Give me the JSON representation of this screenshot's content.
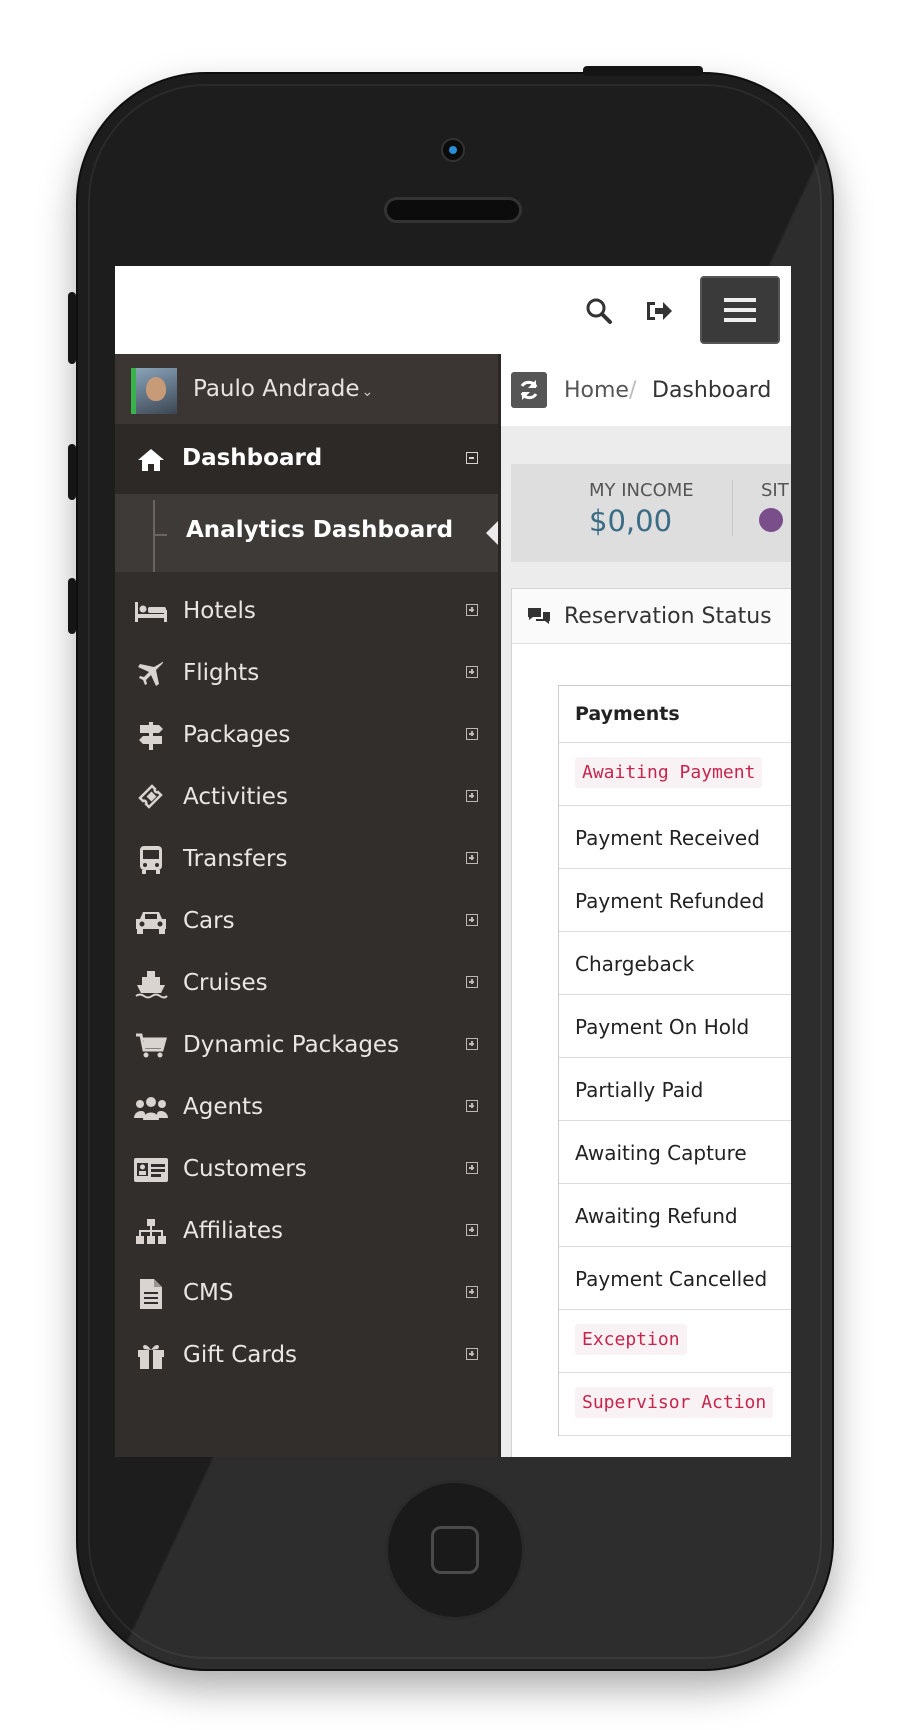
{
  "topbar": {
    "search_icon": "search-icon",
    "logout_icon": "sign-out-icon",
    "menu_icon": "hamburger-icon"
  },
  "user": {
    "name": "Paulo Andrade",
    "caret": "⌄"
  },
  "nav": {
    "dashboard": {
      "label": "Dashboard",
      "icon": "home-icon"
    },
    "analytics": {
      "label": "Analytics Dashboard"
    },
    "items": [
      {
        "label": "Hotels",
        "icon": "bed-icon"
      },
      {
        "label": "Flights",
        "icon": "plane-icon"
      },
      {
        "label": "Packages",
        "icon": "signpost-icon"
      },
      {
        "label": "Activities",
        "icon": "ticket-icon"
      },
      {
        "label": "Transfers",
        "icon": "bus-icon"
      },
      {
        "label": "Cars",
        "icon": "car-icon"
      },
      {
        "label": "Cruises",
        "icon": "ship-icon"
      },
      {
        "label": "Dynamic Packages",
        "icon": "cart-icon"
      },
      {
        "label": "Agents",
        "icon": "users-icon"
      },
      {
        "label": "Customers",
        "icon": "id-card-icon"
      },
      {
        "label": "Affiliates",
        "icon": "sitemap-icon"
      },
      {
        "label": "CMS",
        "icon": "file-icon"
      },
      {
        "label": "Gift Cards",
        "icon": "gift-icon"
      }
    ]
  },
  "breadcrumb": {
    "home": "Home",
    "separator": "/",
    "current": "Dashboard"
  },
  "stats": {
    "income_label": "MY INCOME",
    "income_value": "$0,00",
    "second_label": "SIT"
  },
  "panel": {
    "title": "Reservation Status",
    "table_header": "Payments",
    "rows": [
      {
        "text": "Awaiting Payment",
        "style": "code"
      },
      {
        "text": "Payment Received",
        "style": "plain"
      },
      {
        "text": "Payment Refunded",
        "style": "plain"
      },
      {
        "text": "Chargeback",
        "style": "plain"
      },
      {
        "text": "Payment On Hold",
        "style": "plain"
      },
      {
        "text": "Partially Paid",
        "style": "plain"
      },
      {
        "text": "Awaiting Capture",
        "style": "plain"
      },
      {
        "text": "Awaiting Refund",
        "style": "plain"
      },
      {
        "text": "Payment Cancelled",
        "style": "plain"
      },
      {
        "text": "Exception",
        "style": "code"
      },
      {
        "text": "Supervisor Action",
        "style": "code"
      }
    ]
  },
  "colors": {
    "sidebar_bg": "#322e2c",
    "income_value": "#3b6c86",
    "code_text": "#c7254e",
    "avatar_accent": "#38b349"
  }
}
